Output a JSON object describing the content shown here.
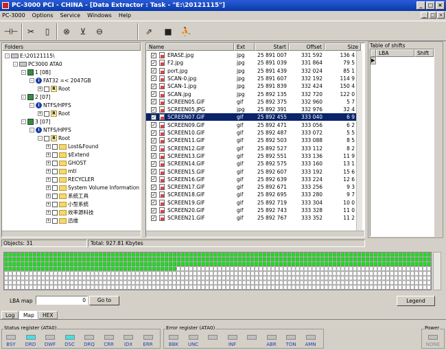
{
  "window": {
    "title": "PC-3000 PCI - CHINA - [Data Extractor : Task - \"E:\\20121115\"]"
  },
  "menu": [
    "PC-3000",
    "Options",
    "Service",
    "Windows",
    "Help"
  ],
  "folders": {
    "header": "Folders",
    "tree": [
      {
        "level": 0,
        "label": "E:\\20121115\\",
        "icon": "drive-icon",
        "toggle": "-",
        "check": false
      },
      {
        "level": 1,
        "label": "PC3000 ATA0",
        "icon": "drive-icon",
        "toggle": "-",
        "check": false
      },
      {
        "level": 2,
        "label": "1 [0B]",
        "icon": "disk-icon",
        "toggle": "-",
        "check": false
      },
      {
        "level": 3,
        "label": "FAT32 =< 2047GB",
        "icon": "info-icon",
        "toggle": "-",
        "check": false
      },
      {
        "level": 4,
        "label": "Root",
        "icon": "root-icon",
        "toggle": "+",
        "check": true
      },
      {
        "level": 2,
        "label": "2 [07]",
        "icon": "disk-icon",
        "toggle": "-",
        "check": false
      },
      {
        "level": 3,
        "label": "NTFS/HPFS",
        "icon": "info-icon",
        "toggle": "-",
        "check": false
      },
      {
        "level": 4,
        "label": "Root",
        "icon": "root-icon",
        "toggle": "+",
        "check": true
      },
      {
        "level": 2,
        "label": "3 [07]",
        "icon": "disk-icon",
        "toggle": "-",
        "check": false
      },
      {
        "level": 3,
        "label": "NTFS/HPFS",
        "icon": "info-icon",
        "toggle": "-",
        "check": false
      },
      {
        "level": 4,
        "label": "Root",
        "icon": "root-icon",
        "toggle": "-",
        "check": true
      },
      {
        "level": 5,
        "label": "Lost&Found",
        "icon": "folder-icon",
        "toggle": "+",
        "check": true
      },
      {
        "level": 5,
        "label": "$Extend",
        "icon": "folder-icon",
        "toggle": "+",
        "check": true
      },
      {
        "level": 5,
        "label": "GHOST",
        "icon": "folder-icon",
        "toggle": "+",
        "check": true
      },
      {
        "level": 5,
        "label": "mtl",
        "icon": "folder-icon",
        "toggle": "+",
        "check": true
      },
      {
        "level": 5,
        "label": "RECYCLER",
        "icon": "folder-icon",
        "toggle": "+",
        "check": true
      },
      {
        "level": 5,
        "label": "System Volume Information",
        "icon": "folder-icon",
        "toggle": "+",
        "check": true
      },
      {
        "level": 5,
        "label": "系统工具",
        "icon": "folder-icon",
        "toggle": "+",
        "check": true
      },
      {
        "level": 5,
        "label": "小型系统",
        "icon": "folder-icon",
        "toggle": "+",
        "check": true
      },
      {
        "level": 5,
        "label": "效率源科技",
        "icon": "folder-icon",
        "toggle": "+",
        "check": true
      },
      {
        "level": 5,
        "label": "迅维",
        "icon": "folder-icon",
        "toggle": "+",
        "check": true
      }
    ]
  },
  "files": {
    "columns": {
      "name": "Name",
      "ext": "Ext",
      "start": "Start",
      "offset": "Offset",
      "size": "Size"
    },
    "rows": [
      {
        "name": "ERASE.jpg",
        "ext": "jpg",
        "start": "25 891 007",
        "offset": "331 592",
        "size": "136 4"
      },
      {
        "name": "F2.jpg",
        "ext": "jpg",
        "start": "25 891 039",
        "offset": "331 864",
        "size": "79 5"
      },
      {
        "name": "port.jpg",
        "ext": "jpg",
        "start": "25 891 439",
        "offset": "332 024",
        "size": "85 1"
      },
      {
        "name": "SCAN-0.jpg",
        "ext": "jpg",
        "start": "25 891 607",
        "offset": "332 192",
        "size": "114 9"
      },
      {
        "name": "SCAN-1.jpg",
        "ext": "jpg",
        "start": "25 891 839",
        "offset": "332 424",
        "size": "150 4"
      },
      {
        "name": "SCAN.jpg",
        "ext": "jpg",
        "start": "25 892 135",
        "offset": "332 720",
        "size": "122 0"
      },
      {
        "name": "SCREEN05.GIF",
        "ext": "gif",
        "start": "25 892 375",
        "offset": "332 960",
        "size": "5 7"
      },
      {
        "name": "SCREEN05.JPG",
        "ext": "jpg",
        "start": "25 892 391",
        "offset": "332 976",
        "size": "32 4"
      },
      {
        "name": "SCREEN07.GIF",
        "ext": "gif",
        "start": "25 892 455",
        "offset": "333 040",
        "size": "6 9",
        "selected": true
      },
      {
        "name": "SCREEN09.GIF",
        "ext": "gif",
        "start": "25 892 471",
        "offset": "333 056",
        "size": "6 2"
      },
      {
        "name": "SCREEN10.GIF",
        "ext": "gif",
        "start": "25 892 487",
        "offset": "333 072",
        "size": "5 5"
      },
      {
        "name": "SCREEN11.GIF",
        "ext": "gif",
        "start": "25 892 503",
        "offset": "333 088",
        "size": "8 5"
      },
      {
        "name": "SCREEN12.GIF",
        "ext": "gif",
        "start": "25 892 527",
        "offset": "333 112",
        "size": "8 2"
      },
      {
        "name": "SCREEN13.GIF",
        "ext": "gif",
        "start": "25 892 551",
        "offset": "333 136",
        "size": "11 9"
      },
      {
        "name": "SCREEN14.GIF",
        "ext": "gif",
        "start": "25 892 575",
        "offset": "333 160",
        "size": "13 1"
      },
      {
        "name": "SCREEN15.GIF",
        "ext": "gif",
        "start": "25 892 607",
        "offset": "333 192",
        "size": "15 6"
      },
      {
        "name": "SCREEN16.GIF",
        "ext": "gif",
        "start": "25 892 639",
        "offset": "333 224",
        "size": "12 6"
      },
      {
        "name": "SCREEN17.GIF",
        "ext": "gif",
        "start": "25 892 671",
        "offset": "333 256",
        "size": "9 3"
      },
      {
        "name": "SCREEN18.GIF",
        "ext": "gif",
        "start": "25 892 695",
        "offset": "333 280",
        "size": "9 7"
      },
      {
        "name": "SCREEN19.GIF",
        "ext": "gif",
        "start": "25 892 719",
        "offset": "333 304",
        "size": "10 0"
      },
      {
        "name": "SCREEN20.GIF",
        "ext": "gif",
        "start": "25 892 743",
        "offset": "333 328",
        "size": "11 0"
      },
      {
        "name": "SCREEN21.GIF",
        "ext": "gif",
        "start": "25 892 767",
        "offset": "333 352",
        "size": "11 2"
      }
    ]
  },
  "shifts": {
    "header": "Table of shifts",
    "columns": {
      "lba": "LBA",
      "shift": "Shift"
    }
  },
  "status": {
    "objects": "Objects: 31",
    "total": "Total: 927.81 Kbytes"
  },
  "map": {
    "rows": 8,
    "cols": 104,
    "green_cells": 354,
    "lba_label": "LBA map",
    "lba_value": "0",
    "goto_label": "Go to",
    "legend_label": "Legend",
    "colors": {
      "read": "#19e019",
      "empty": "#ffffff",
      "grid": "#7a7a7a"
    }
  },
  "tabs": [
    "Log",
    "Map",
    "HEX"
  ],
  "status_register": {
    "title": "Status register (ATA0)",
    "leds": [
      {
        "label": "BSY",
        "on": false
      },
      {
        "label": "DRD",
        "on": true
      },
      {
        "label": "DWF",
        "on": false
      },
      {
        "label": "DSC",
        "on": true
      },
      {
        "label": "DRQ",
        "on": false
      },
      {
        "label": "CRR",
        "on": false
      },
      {
        "label": "IDX",
        "on": false
      },
      {
        "label": "ERR",
        "on": false
      }
    ]
  },
  "error_register": {
    "title": "Error register (ATA0)",
    "leds": [
      {
        "label": "BBK",
        "on": false
      },
      {
        "label": "UNC",
        "on": false
      },
      {
        "label": "",
        "on": false
      },
      {
        "label": "INF",
        "on": false
      },
      {
        "label": "",
        "on": false
      },
      {
        "label": "ABR",
        "on": false
      },
      {
        "label": "TON",
        "on": false
      },
      {
        "label": "AMN",
        "on": false
      }
    ]
  },
  "power": {
    "title": "Power",
    "value": "NONE"
  }
}
